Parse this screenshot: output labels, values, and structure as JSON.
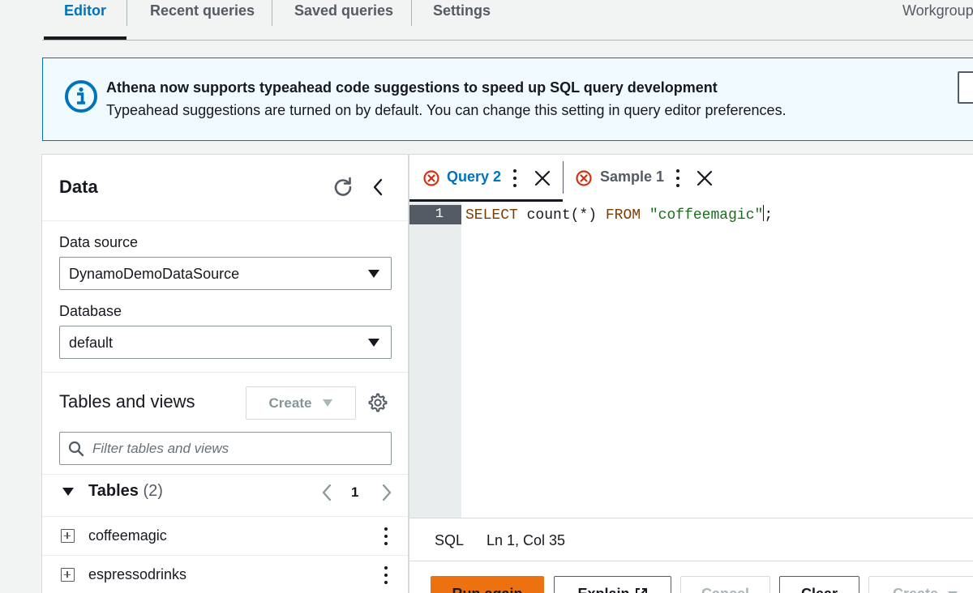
{
  "tabs": [
    "Editor",
    "Recent queries",
    "Saved queries",
    "Settings"
  ],
  "workgroup_label": "Workgroup",
  "banner": {
    "title": "Athena now supports typeahead code suggestions to speed up SQL query development",
    "text": "Typeahead suggestions are turned on by default. You can change this setting in query editor preferences."
  },
  "data_panel": {
    "title": "Data",
    "data_source_label": "Data source",
    "data_source_value": "DynamoDemoDataSource",
    "database_label": "Database",
    "database_value": "default",
    "tables_views_title": "Tables and views",
    "create_label": "Create",
    "filter_placeholder": "Filter tables and views",
    "tables_label": "Tables",
    "tables_count": "(2)",
    "page_number": "1",
    "tables": [
      "coffeemagic",
      "espressodrinks"
    ]
  },
  "editor": {
    "tabs": [
      "Query 2",
      "Sample 1"
    ],
    "line_number": "1",
    "code": {
      "kw1": "SELECT",
      "fn": " count(*) ",
      "kw2": "FROM",
      "space": " ",
      "str": "\"coffeemagic\"",
      "end": ";"
    },
    "language": "SQL",
    "cursor_position": "Ln 1, Col 35"
  },
  "actions": [
    "Run again",
    "Explain",
    "Cancel",
    "Clear",
    "Create"
  ],
  "colors": {
    "link_blue": "#0073bb",
    "error_red": "#d13212",
    "primary_orange": "#ec7211"
  }
}
